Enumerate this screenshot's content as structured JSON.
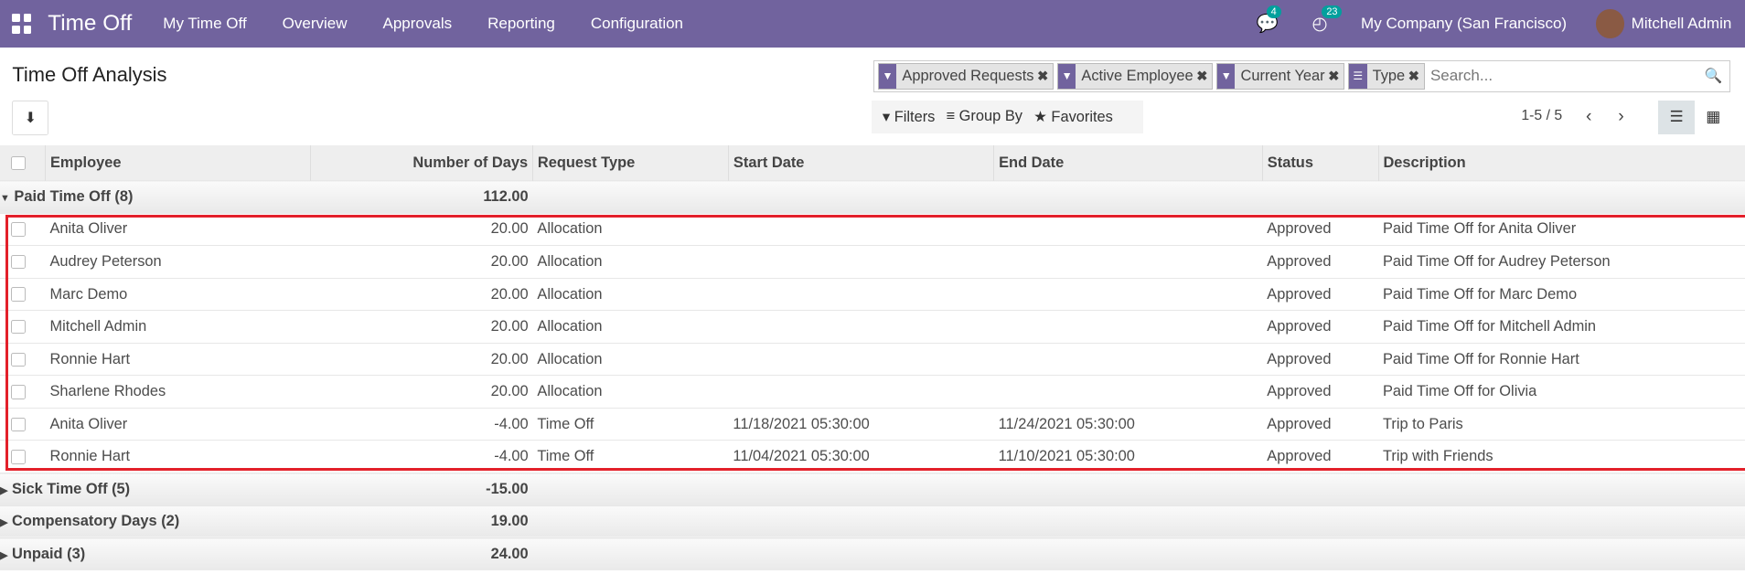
{
  "nav": {
    "app": "Time Off",
    "menus": [
      "My Time Off",
      "Overview",
      "Approvals",
      "Reporting",
      "Configuration"
    ],
    "messages_count": "4",
    "activities_count": "23",
    "company": "My Company (San Francisco)",
    "user": "Mitchell Admin",
    "color": "#71639e"
  },
  "page": {
    "title": "Time Off Analysis"
  },
  "search": {
    "facets": [
      {
        "icon": "filter-icon",
        "label": "Approved Requests"
      },
      {
        "icon": "filter-icon",
        "label": "Active Employee"
      },
      {
        "icon": "filter-icon",
        "label": "Current Year"
      },
      {
        "icon": "group-icon",
        "label": "Type"
      }
    ],
    "placeholder": "Search..."
  },
  "filters": {
    "filters": "Filters",
    "group_by": "Group By",
    "favorites": "Favorites"
  },
  "pager": "1-5 / 5",
  "columns": [
    "Employee",
    "Number of Days",
    "Request Type",
    "Start Date",
    "End Date",
    "Status",
    "Description"
  ],
  "groups": [
    {
      "label": "Paid Time Off (8)",
      "total": "112.00",
      "expanded": true,
      "rows": [
        [
          "Anita Oliver",
          "20.00",
          "Allocation",
          "",
          "",
          "Approved",
          "Paid Time Off for Anita Oliver"
        ],
        [
          "Audrey Peterson",
          "20.00",
          "Allocation",
          "",
          "",
          "Approved",
          "Paid Time Off for Audrey Peterson"
        ],
        [
          "Marc Demo",
          "20.00",
          "Allocation",
          "",
          "",
          "Approved",
          "Paid Time Off for Marc Demo"
        ],
        [
          "Mitchell Admin",
          "20.00",
          "Allocation",
          "",
          "",
          "Approved",
          "Paid Time Off for Mitchell Admin"
        ],
        [
          "Ronnie Hart",
          "20.00",
          "Allocation",
          "",
          "",
          "Approved",
          "Paid Time Off for Ronnie Hart"
        ],
        [
          "Sharlene Rhodes",
          "20.00",
          "Allocation",
          "",
          "",
          "Approved",
          "Paid Time Off for Olivia"
        ],
        [
          "Anita Oliver",
          "-4.00",
          "Time Off",
          "11/18/2021 05:30:00",
          "11/24/2021 05:30:00",
          "Approved",
          "Trip to Paris"
        ],
        [
          "Ronnie Hart",
          "-4.00",
          "Time Off",
          "11/04/2021 05:30:00",
          "11/10/2021 05:30:00",
          "Approved",
          "Trip with Friends"
        ]
      ]
    },
    {
      "label": "Sick Time Off (5)",
      "total": "-15.00",
      "expanded": false,
      "rows": []
    },
    {
      "label": "Compensatory Days (2)",
      "total": "19.00",
      "expanded": false,
      "rows": []
    },
    {
      "label": "Unpaid (3)",
      "total": "24.00",
      "expanded": false,
      "rows": []
    }
  ]
}
